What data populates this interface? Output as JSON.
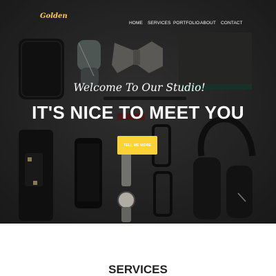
{
  "brand": {
    "logo": "Golden",
    "accent_color": "#fed136"
  },
  "nav": {
    "items": [
      {
        "label": "HOME"
      },
      {
        "label": "SERVICES"
      },
      {
        "label": "PORTFOLIO"
      },
      {
        "label": "ABOUT"
      },
      {
        "label": "CONTACT"
      }
    ]
  },
  "hero": {
    "subheading": "Welcome To Our Studio!",
    "heading": "IT'S NICE TO MEET YOU",
    "cta_label": "TELL ME MORE"
  },
  "services": {
    "title": "SERVICES"
  }
}
